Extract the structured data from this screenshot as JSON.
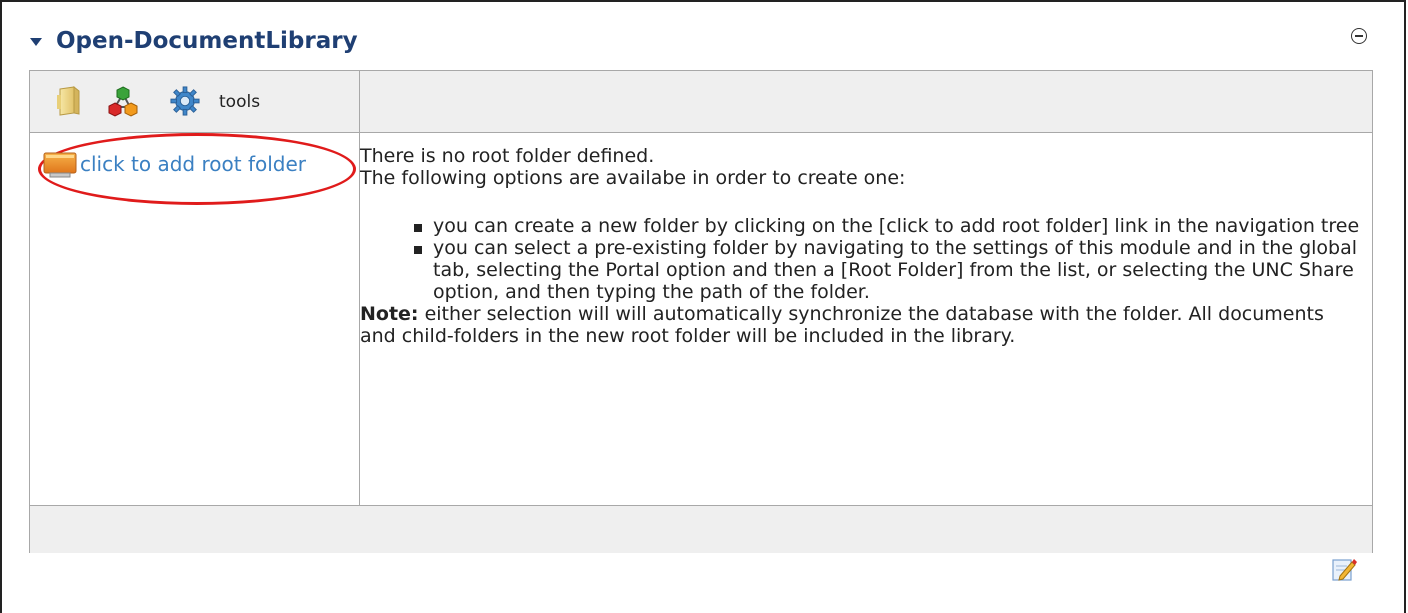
{
  "module": {
    "title": "Open-DocumentLibrary"
  },
  "toolbar": {
    "tools_label": "tools",
    "icons": [
      "document-icon",
      "hierarchy-icon",
      "gear-icon"
    ]
  },
  "tree": {
    "add_root_label": "click to add root folder"
  },
  "content": {
    "line1": "There is no root folder defined.",
    "line2": "The following options are availabe in order to create one:",
    "options": [
      "you can create a new folder by clicking on the [click to add root folder] link in the navigation tree",
      "you can select a pre-existing folder by navigating to the settings of this module and in the global tab, selecting the Portal option and then a [Root Folder] from the list, or selecting the UNC Share option, and then typing the path of the folder."
    ],
    "note_label": "Note:",
    "note_text": " either selection will will automatically synchronize the database with the folder. All documents and child-folders in the new root folder will be included in the library."
  },
  "colors": {
    "title": "#1f3f73",
    "link": "#3b80c2",
    "highlight_ellipse": "#e01b1b",
    "row_bg": "#efefef"
  }
}
